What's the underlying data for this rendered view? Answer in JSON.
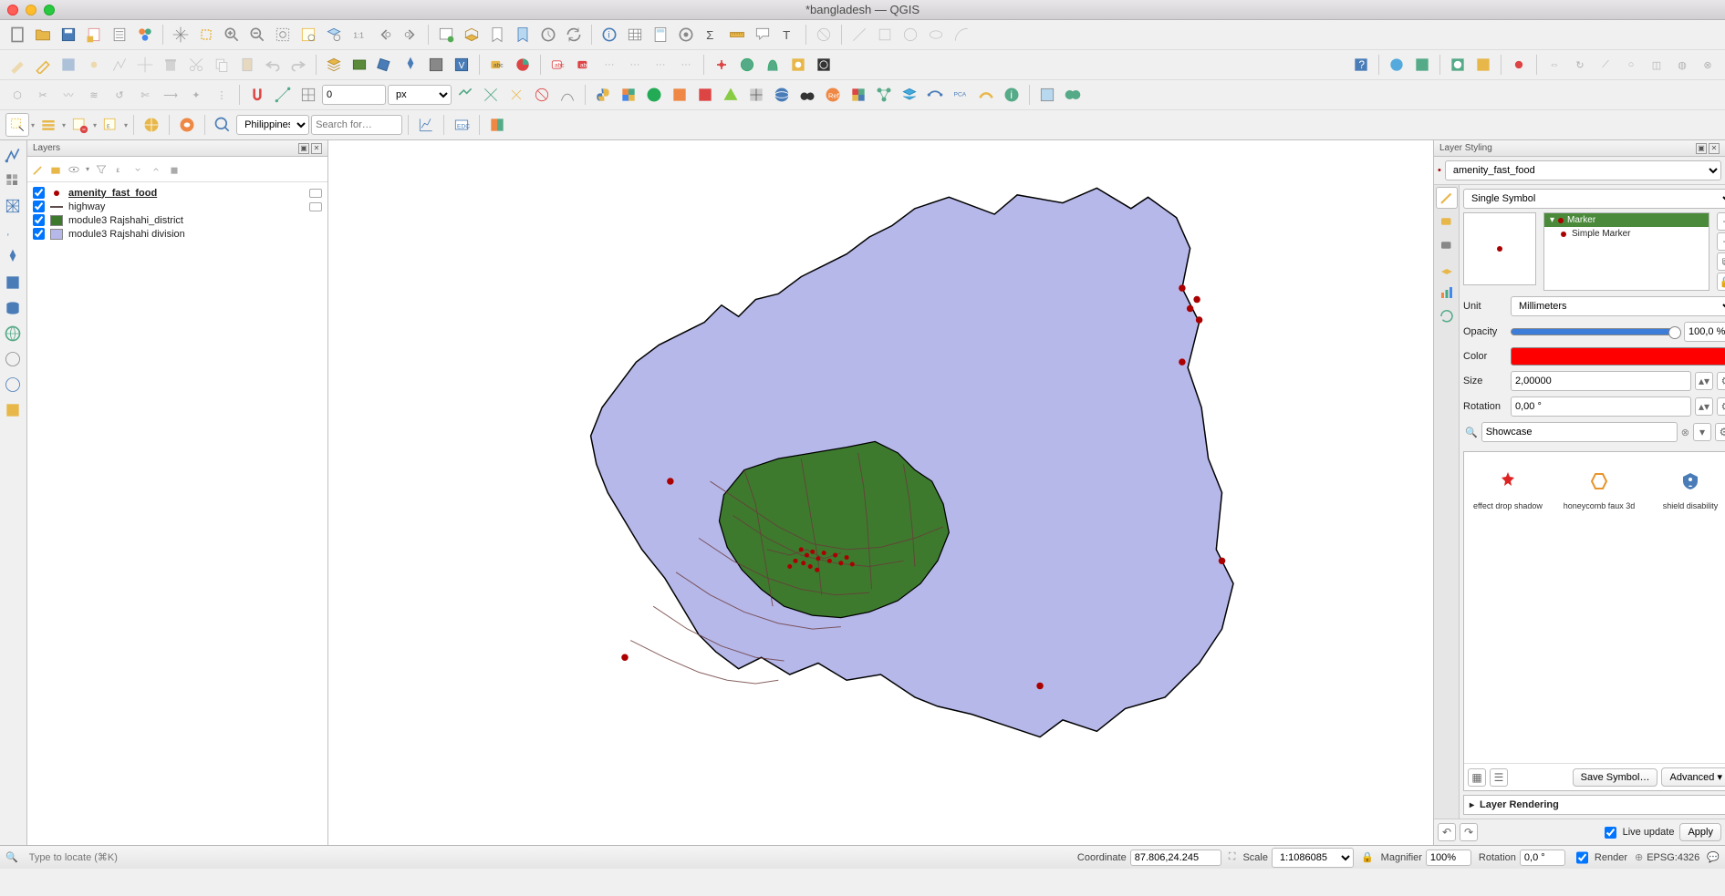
{
  "window": {
    "title": "*bangladesh — QGIS"
  },
  "layers_panel": {
    "title": "Layers",
    "items": [
      {
        "checked": true,
        "type": "point",
        "name": "amenity_fast_food",
        "bold": true
      },
      {
        "checked": true,
        "type": "line",
        "name": "highway"
      },
      {
        "checked": true,
        "type": "poly",
        "color": "#3d7a2e",
        "name": "module3 Rajshahi_district"
      },
      {
        "checked": true,
        "type": "poly",
        "color": "#b6b8ea",
        "name": "module3 Rajshahi division"
      }
    ]
  },
  "style_panel": {
    "title": "Layer Styling",
    "layer": "amenity_fast_food",
    "renderer": "Single Symbol",
    "tree_header": "Marker",
    "tree_item": "Simple Marker",
    "unit_label": "Unit",
    "unit": "Millimeters",
    "opacity_label": "Opacity",
    "opacity": "100,0 %",
    "color_label": "Color",
    "size_label": "Size",
    "size": "2,00000",
    "rotation_label": "Rotation",
    "rotation": "0,00 °",
    "search": "Showcase",
    "showcase": [
      {
        "label": "effect drop shadow"
      },
      {
        "label": "honeycomb faux 3d"
      },
      {
        "label": "shield disability"
      }
    ],
    "save_symbol": "Save Symbol…",
    "advanced": "Advanced",
    "rendering": "Layer Rendering",
    "live_update": "Live update",
    "apply": "Apply"
  },
  "locator": {
    "placeholder": "Type to locate (⌘K)"
  },
  "nominatim": {
    "region": "Philippines",
    "placeholder": "Search for…"
  },
  "snap_value": "0",
  "snap_unit": "px",
  "status": {
    "coord_label": "Coordinate",
    "coord": "87.806,24.245",
    "scale_label": "Scale",
    "scale": "1:1086085",
    "magnifier_label": "Magnifier",
    "magnifier": "100%",
    "rotation_label": "Rotation",
    "rotation": "0,0 °",
    "render": "Render",
    "crs": "EPSG:4326"
  }
}
